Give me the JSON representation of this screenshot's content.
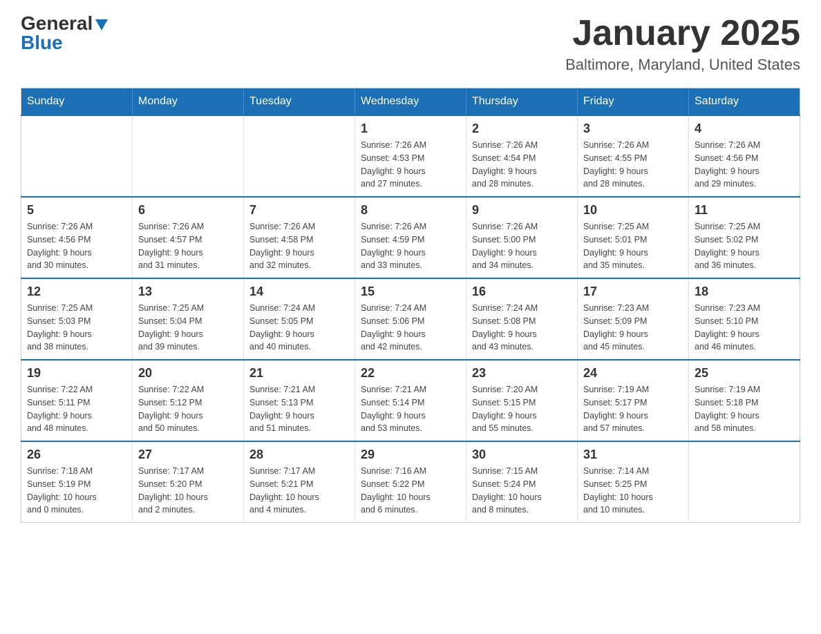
{
  "logo": {
    "general": "General",
    "blue": "Blue"
  },
  "title": "January 2025",
  "subtitle": "Baltimore, Maryland, United States",
  "days_of_week": [
    "Sunday",
    "Monday",
    "Tuesday",
    "Wednesday",
    "Thursday",
    "Friday",
    "Saturday"
  ],
  "weeks": [
    [
      {
        "day": "",
        "info": ""
      },
      {
        "day": "",
        "info": ""
      },
      {
        "day": "",
        "info": ""
      },
      {
        "day": "1",
        "info": "Sunrise: 7:26 AM\nSunset: 4:53 PM\nDaylight: 9 hours\nand 27 minutes."
      },
      {
        "day": "2",
        "info": "Sunrise: 7:26 AM\nSunset: 4:54 PM\nDaylight: 9 hours\nand 28 minutes."
      },
      {
        "day": "3",
        "info": "Sunrise: 7:26 AM\nSunset: 4:55 PM\nDaylight: 9 hours\nand 28 minutes."
      },
      {
        "day": "4",
        "info": "Sunrise: 7:26 AM\nSunset: 4:56 PM\nDaylight: 9 hours\nand 29 minutes."
      }
    ],
    [
      {
        "day": "5",
        "info": "Sunrise: 7:26 AM\nSunset: 4:56 PM\nDaylight: 9 hours\nand 30 minutes."
      },
      {
        "day": "6",
        "info": "Sunrise: 7:26 AM\nSunset: 4:57 PM\nDaylight: 9 hours\nand 31 minutes."
      },
      {
        "day": "7",
        "info": "Sunrise: 7:26 AM\nSunset: 4:58 PM\nDaylight: 9 hours\nand 32 minutes."
      },
      {
        "day": "8",
        "info": "Sunrise: 7:26 AM\nSunset: 4:59 PM\nDaylight: 9 hours\nand 33 minutes."
      },
      {
        "day": "9",
        "info": "Sunrise: 7:26 AM\nSunset: 5:00 PM\nDaylight: 9 hours\nand 34 minutes."
      },
      {
        "day": "10",
        "info": "Sunrise: 7:25 AM\nSunset: 5:01 PM\nDaylight: 9 hours\nand 35 minutes."
      },
      {
        "day": "11",
        "info": "Sunrise: 7:25 AM\nSunset: 5:02 PM\nDaylight: 9 hours\nand 36 minutes."
      }
    ],
    [
      {
        "day": "12",
        "info": "Sunrise: 7:25 AM\nSunset: 5:03 PM\nDaylight: 9 hours\nand 38 minutes."
      },
      {
        "day": "13",
        "info": "Sunrise: 7:25 AM\nSunset: 5:04 PM\nDaylight: 9 hours\nand 39 minutes."
      },
      {
        "day": "14",
        "info": "Sunrise: 7:24 AM\nSunset: 5:05 PM\nDaylight: 9 hours\nand 40 minutes."
      },
      {
        "day": "15",
        "info": "Sunrise: 7:24 AM\nSunset: 5:06 PM\nDaylight: 9 hours\nand 42 minutes."
      },
      {
        "day": "16",
        "info": "Sunrise: 7:24 AM\nSunset: 5:08 PM\nDaylight: 9 hours\nand 43 minutes."
      },
      {
        "day": "17",
        "info": "Sunrise: 7:23 AM\nSunset: 5:09 PM\nDaylight: 9 hours\nand 45 minutes."
      },
      {
        "day": "18",
        "info": "Sunrise: 7:23 AM\nSunset: 5:10 PM\nDaylight: 9 hours\nand 46 minutes."
      }
    ],
    [
      {
        "day": "19",
        "info": "Sunrise: 7:22 AM\nSunset: 5:11 PM\nDaylight: 9 hours\nand 48 minutes."
      },
      {
        "day": "20",
        "info": "Sunrise: 7:22 AM\nSunset: 5:12 PM\nDaylight: 9 hours\nand 50 minutes."
      },
      {
        "day": "21",
        "info": "Sunrise: 7:21 AM\nSunset: 5:13 PM\nDaylight: 9 hours\nand 51 minutes."
      },
      {
        "day": "22",
        "info": "Sunrise: 7:21 AM\nSunset: 5:14 PM\nDaylight: 9 hours\nand 53 minutes."
      },
      {
        "day": "23",
        "info": "Sunrise: 7:20 AM\nSunset: 5:15 PM\nDaylight: 9 hours\nand 55 minutes."
      },
      {
        "day": "24",
        "info": "Sunrise: 7:19 AM\nSunset: 5:17 PM\nDaylight: 9 hours\nand 57 minutes."
      },
      {
        "day": "25",
        "info": "Sunrise: 7:19 AM\nSunset: 5:18 PM\nDaylight: 9 hours\nand 58 minutes."
      }
    ],
    [
      {
        "day": "26",
        "info": "Sunrise: 7:18 AM\nSunset: 5:19 PM\nDaylight: 10 hours\nand 0 minutes."
      },
      {
        "day": "27",
        "info": "Sunrise: 7:17 AM\nSunset: 5:20 PM\nDaylight: 10 hours\nand 2 minutes."
      },
      {
        "day": "28",
        "info": "Sunrise: 7:17 AM\nSunset: 5:21 PM\nDaylight: 10 hours\nand 4 minutes."
      },
      {
        "day": "29",
        "info": "Sunrise: 7:16 AM\nSunset: 5:22 PM\nDaylight: 10 hours\nand 6 minutes."
      },
      {
        "day": "30",
        "info": "Sunrise: 7:15 AM\nSunset: 5:24 PM\nDaylight: 10 hours\nand 8 minutes."
      },
      {
        "day": "31",
        "info": "Sunrise: 7:14 AM\nSunset: 5:25 PM\nDaylight: 10 hours\nand 10 minutes."
      },
      {
        "day": "",
        "info": ""
      }
    ]
  ]
}
